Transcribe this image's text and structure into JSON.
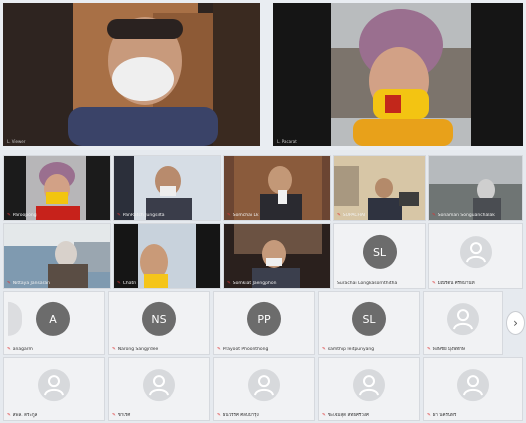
{
  "featured": [
    {
      "name": "L. Viewer"
    },
    {
      "name": "L. Pacarat"
    }
  ],
  "tiles": [
    {
      "label": "Paroopong",
      "type": "video"
    },
    {
      "label": "PanRatch Jungsilta",
      "type": "video"
    },
    {
      "label": "Somchai Lk",
      "type": "video"
    },
    {
      "label": "SUPACHAI",
      "type": "video"
    },
    {
      "label": "Sonaman Songuanchalak",
      "type": "video"
    },
    {
      "label": "Nittaya Jansaran",
      "type": "video"
    },
    {
      "label": "Chatri",
      "type": "video"
    },
    {
      "label": "Somkiat Jaengphon",
      "type": "video"
    },
    {
      "label": "Surachai Longkasornthitha",
      "type": "avatar",
      "initials": "SL"
    },
    {
      "label": "มณีรัตน์ ศรีหมานท์",
      "type": "person"
    },
    {
      "label": "anagarm",
      "type": "avatar-partial",
      "initials": ""
    },
    {
      "label": "amagone",
      "type": "avatar",
      "initials": "A"
    },
    {
      "label": "Narong Sangjrdee",
      "type": "avatar",
      "initials": "NS"
    },
    {
      "label": "Prayoot Phoonthong",
      "type": "avatar",
      "initials": "PP"
    },
    {
      "label": "samthip leitpunyang",
      "type": "avatar",
      "initials": "SL"
    },
    {
      "label": "พงษ์ชัย มุ่งพิทักษ์",
      "type": "person"
    },
    {
      "label": "สพล. ตระกูล",
      "type": "person"
    },
    {
      "label": "ชาเรศ",
      "type": "person"
    },
    {
      "label": "ธนวรรศ์ ศิลปบำรุง",
      "type": "person"
    },
    {
      "label": "ชะเจ็มสุด สิทธิศรีวงศ์",
      "type": "person"
    },
    {
      "label": "ฝ่า นครินทร์",
      "type": "person"
    }
  ],
  "icons": {
    "mic": "muted-mic-icon",
    "person": "person-placeholder-icon",
    "next": "chevron-right-icon"
  },
  "nav": {
    "next": "›"
  },
  "colors": {
    "background": "#e6eaef",
    "tile": "#f1f2f4",
    "avatar": "#6c6c6c",
    "mic": "#d33333"
  }
}
